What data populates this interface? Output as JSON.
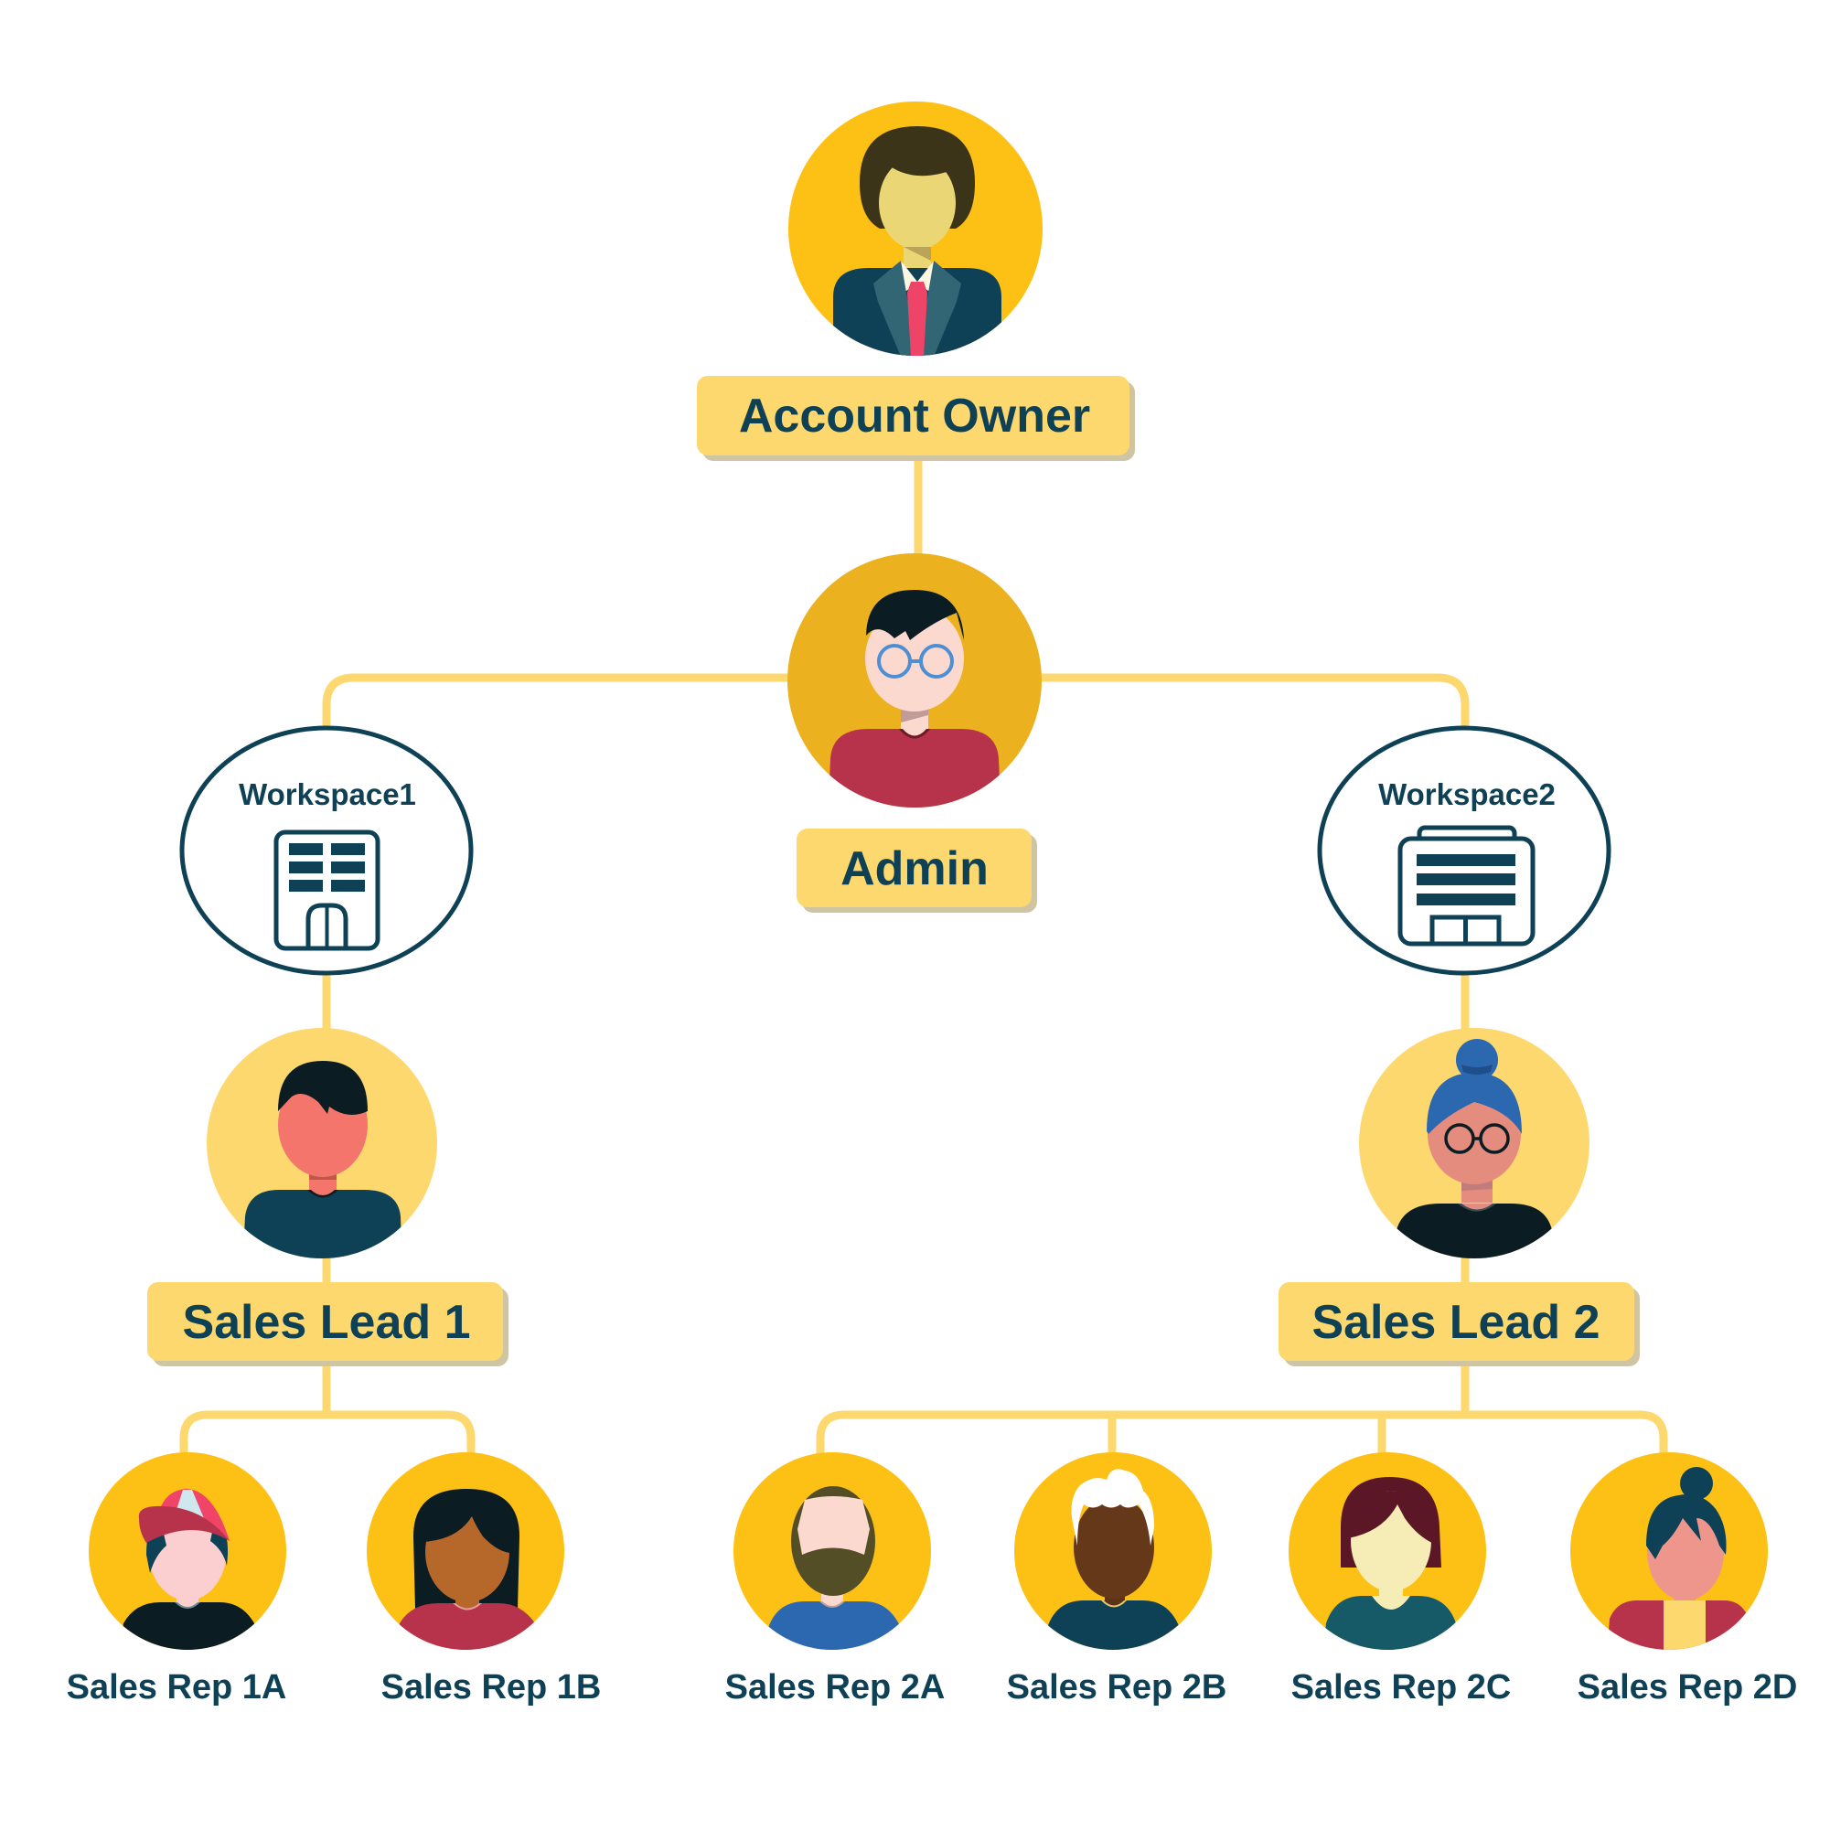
{
  "diagram": {
    "type": "org-chart",
    "colors": {
      "connector": "#fdd86e",
      "label_bg": "#fdd86e",
      "label_shadow": "#cfc5a2",
      "text": "#0e4155",
      "circle_primary": "#fdc015",
      "circle_admin": "#ecb11f",
      "circle_lead": "#fdd86e",
      "workspace_stroke": "#0e4155"
    },
    "nodes": {
      "account_owner": {
        "label": "Account Owner",
        "avatar": "businessman-avatar"
      },
      "admin": {
        "label": "Admin",
        "avatar": "person-with-glasses-avatar"
      },
      "workspace1": {
        "label": "Workspace1",
        "icon": "office-building-icon"
      },
      "workspace2": {
        "label": "Workspace2",
        "icon": "warehouse-building-icon"
      },
      "sales_lead_1": {
        "label": "Sales Lead 1",
        "avatar": "man-avatar"
      },
      "sales_lead_2": {
        "label": "Sales Lead 2",
        "avatar": "woman-with-bun-and-glasses-avatar"
      },
      "reps": [
        {
          "label": "Sales Rep 1A",
          "avatar": "man-with-cap-avatar"
        },
        {
          "label": "Sales Rep 1B",
          "avatar": "woman-long-hair-avatar"
        },
        {
          "label": "Sales Rep 2A",
          "avatar": "bearded-man-avatar"
        },
        {
          "label": "Sales Rep 2B",
          "avatar": "older-man-white-hair-avatar"
        },
        {
          "label": "Sales Rep 2C",
          "avatar": "woman-bob-hair-avatar"
        },
        {
          "label": "Sales Rep 2D",
          "avatar": "woman-with-bun-avatar"
        }
      ]
    },
    "edges": [
      [
        "Account Owner",
        "Admin"
      ],
      [
        "Admin",
        "Workspace1"
      ],
      [
        "Admin",
        "Workspace2"
      ],
      [
        "Workspace1",
        "Sales Lead 1"
      ],
      [
        "Workspace2",
        "Sales Lead 2"
      ],
      [
        "Sales Lead 1",
        "Sales Rep 1A"
      ],
      [
        "Sales Lead 1",
        "Sales Rep 1B"
      ],
      [
        "Sales Lead 2",
        "Sales Rep 2A"
      ],
      [
        "Sales Lead 2",
        "Sales Rep 2B"
      ],
      [
        "Sales Lead 2",
        "Sales Rep 2C"
      ],
      [
        "Sales Lead 2",
        "Sales Rep 2D"
      ]
    ]
  }
}
